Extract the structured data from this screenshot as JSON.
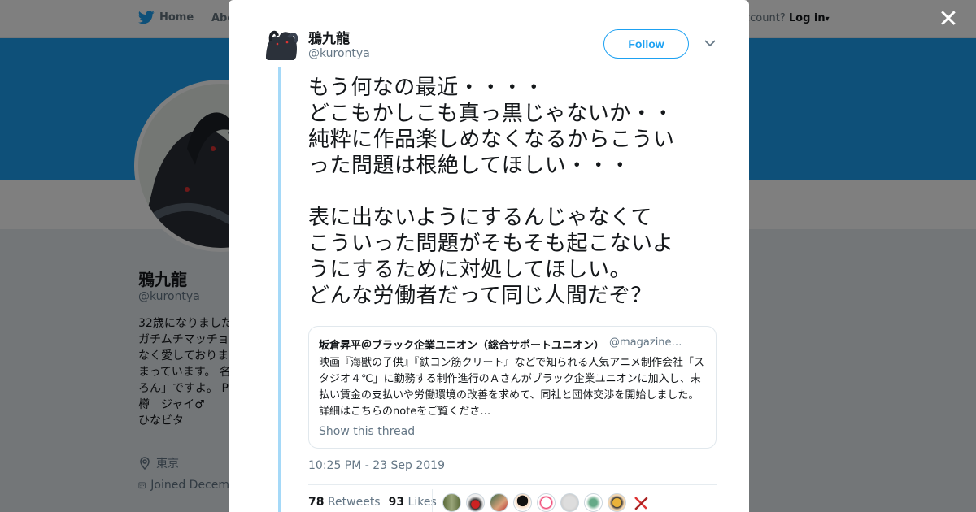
{
  "bg": {
    "nav_home": "Home",
    "nav_about": "Abo",
    "nav_account": "ccount?",
    "nav_login": "Log in",
    "profile_name": "鴉九龍",
    "profile_handle": "@kurontya",
    "bio_lines": [
      "32歳になりました",
      "ガチムチマッチョ",
      "なく愛しておりま",
      "まっています。 名",
      "ろん」ですよ。 P",
      "樽　ジャイ♂",
      "ひなビタ"
    ],
    "location": "東京",
    "joined": "Joined Decem"
  },
  "tweet": {
    "name": "鴉九龍",
    "handle": "@kurontya",
    "follow_label": "Follow",
    "text": "もう何なの最近・・・・\nどこもかしこも真っ黒じゃないか・・\n純粋に作品楽しめなくなるからこうい\nった問題は根絶してほしい・・・\n\n表に出ないようにするんじゃなくて\nこういった問題がそもそも起こないよ\nうにするために対処してほしい。\nどんな労働者だって同じ人間だぞ？",
    "quote": {
      "name": "坂倉昇平＠ブラック企業ユニオン（総合サポートユニオン）",
      "handle": "@magazine…",
      "body": "映画『海獣の子供』『鉄コン筋クリート』などで知られる人気アニメ制作会社「スタジオ４℃」に勤務する制作進行のＡさんがブラック企業ユニオンに加入し、未払い賃金の支払いや労働環境の改善を求めて、同社と団体交渉を開始しました。詳細はこちらのnoteをご覧くださ…",
      "show_thread": "Show this thread"
    },
    "timestamp": "10:25 PM - 23 Sep 2019",
    "retweets_count": "78",
    "retweets_label": "Retweets",
    "likes_count": "93",
    "likes_label": "Likes",
    "liker_count": 9
  },
  "colors": {
    "accent": "#1da1f2",
    "thread_line": "#a5d9f8"
  }
}
